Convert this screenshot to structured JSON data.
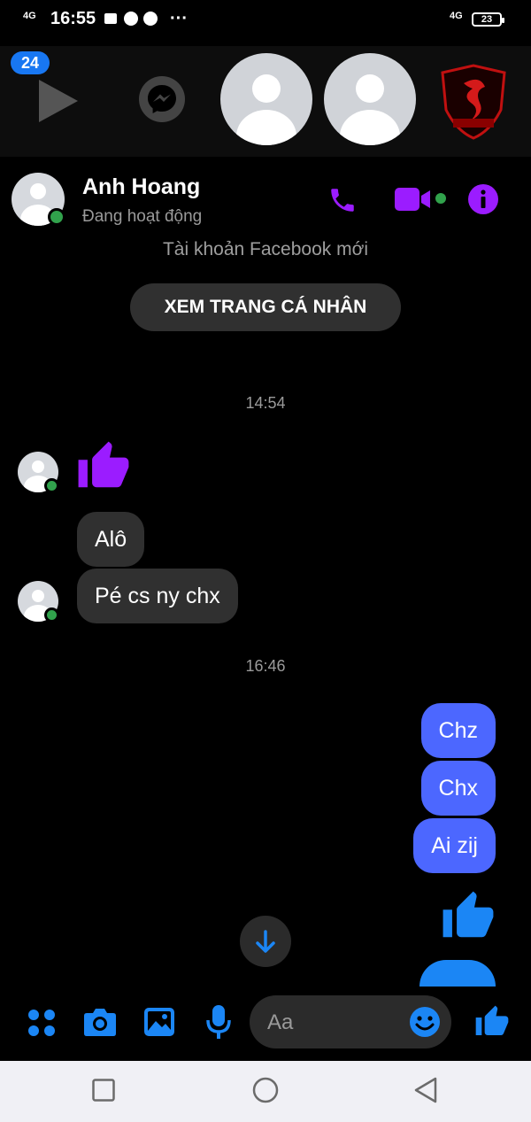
{
  "status_bar": {
    "network_left": "4G",
    "time": "16:55",
    "network_right": "4G",
    "battery": "23",
    "more": "···"
  },
  "chat_heads": {
    "unread_badge": "24",
    "heads": [
      "play-icon",
      "messenger-icon",
      "avatar-placeholder",
      "avatar-placeholder",
      "hydra-logo"
    ]
  },
  "header": {
    "contact_name": "Anh Hoang",
    "presence": "Đang hoạt động",
    "actions": [
      "phone-icon",
      "video-call-icon",
      "info-icon"
    ],
    "accent_color": "#9b1cff"
  },
  "intro": {
    "new_account_note": "Tài khoản Facebook mới",
    "view_profile_label": "XEM TRANG CÁ NHÂN"
  },
  "conversation": {
    "timestamp_1": "14:54",
    "incoming": [
      {
        "type": "like"
      },
      {
        "type": "text",
        "text": "Alô"
      },
      {
        "type": "text",
        "text": "Pé cs ny chx"
      }
    ],
    "timestamp_2": "16:46",
    "outgoing": [
      {
        "type": "text",
        "text": "Chz"
      },
      {
        "type": "text",
        "text": "Chx"
      },
      {
        "type": "text",
        "text": "Ai zij"
      },
      {
        "type": "like"
      }
    ],
    "outgoing_color": "#4c67ff",
    "incoming_color": "#303030"
  },
  "composer": {
    "placeholder": "Aa",
    "icons": [
      "apps-icon",
      "camera-icon",
      "gallery-icon",
      "mic-icon",
      "emoji-icon",
      "like-icon"
    ],
    "icon_color": "#1b86f5"
  },
  "nav_bar": {
    "buttons": [
      "recents-button",
      "home-button",
      "back-button"
    ]
  }
}
